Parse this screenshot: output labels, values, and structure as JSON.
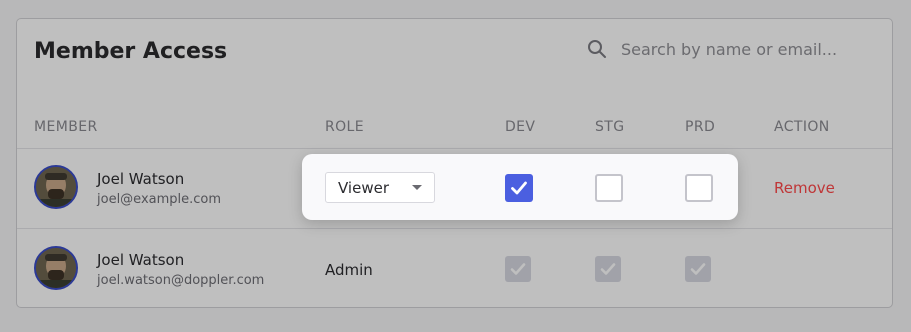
{
  "header": {
    "title": "Member Access",
    "search_placeholder": "Search by name or email..."
  },
  "columns": {
    "member": "MEMBER",
    "role": "ROLE",
    "dev": "DEV",
    "stg": "STG",
    "prd": "PRD",
    "action": "ACTION"
  },
  "rows": [
    {
      "name": "Joel Watson",
      "email": "joel@example.com",
      "role": "Viewer",
      "dev": true,
      "stg": false,
      "prd": false,
      "action": "Remove"
    },
    {
      "name": "Joel Watson",
      "email": "joel.watson@doppler.com",
      "role": "Admin",
      "dev": true,
      "stg": true,
      "prd": true
    }
  ],
  "colors": {
    "accent": "#4b5fe0",
    "danger": "#bf3637",
    "avatar_ring": "#3a4cc9"
  },
  "icons": [
    "search-icon",
    "chevron-down-icon",
    "checkmark-icon",
    "avatar"
  ]
}
